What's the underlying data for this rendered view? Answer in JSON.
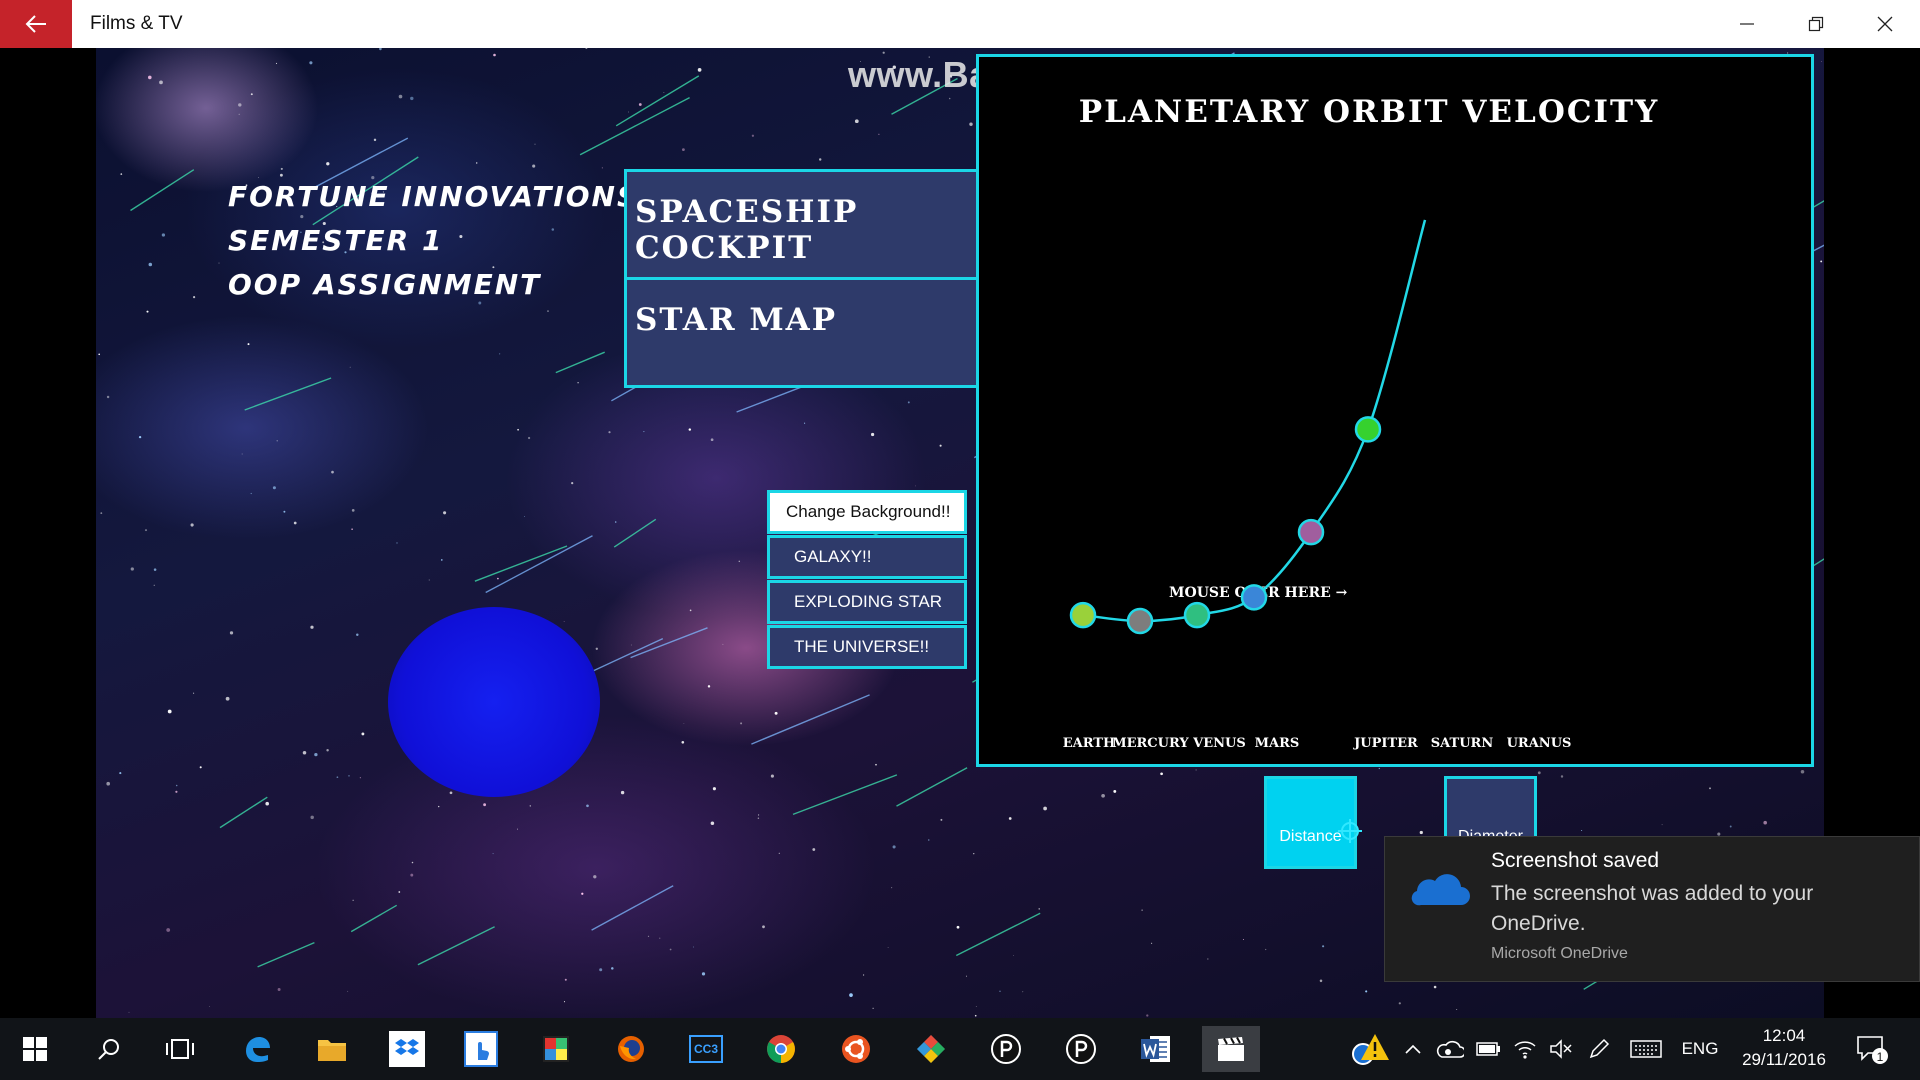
{
  "window": {
    "title": "Films & TV"
  },
  "video": {
    "watermark": "www.Bandicam.com",
    "heading": [
      "FORTUNE INNOVATIONS",
      "SEMESTER 1",
      "OOP ASSIGNMENT"
    ],
    "nav": {
      "spaceship": "SPACESHIP COCKPIT",
      "starmap": "STAR MAP"
    },
    "background_menu": {
      "title": "Change Background!!",
      "items": [
        "GALAXY!!",
        "EXPLODING STAR",
        "THE UNIVERSE!!"
      ]
    },
    "chart_buttons": {
      "distance": "Distance",
      "diameter": "Diameter"
    },
    "colors": {
      "accent": "#1bd6e6",
      "panel": "#2e3a6a",
      "planet": "#1520f0"
    }
  },
  "chart_data": {
    "type": "line",
    "title": "PLANETARY ORBIT VELOCITY",
    "annotation": "MOUSE OVER HERE →",
    "categories": [
      "EARTH",
      "MERCURY",
      "VENUS",
      "MARS",
      "JUPITER",
      "SATURN",
      "URANUS"
    ],
    "category_labels": [
      "EARTH",
      "MERCURY VENUS",
      "MARS",
      "JUPITER",
      "SATURN",
      "URANUS"
    ],
    "values": [
      0.5,
      0.2,
      0.5,
      1.4,
      4.7,
      9.9,
      20.5
    ],
    "marker_colors": [
      "#9ad13a",
      "#7d7d7d",
      "#2fbf80",
      "#3a86d8",
      "#a05e9e",
      "#36d12e",
      "#2c6fd6"
    ],
    "line_color": "#22d8e6",
    "ylim": [
      0,
      25
    ],
    "grid": false
  },
  "toast": {
    "title": "Screenshot saved",
    "body": "The screenshot was added to your OneDrive.",
    "source": "Microsoft OneDrive",
    "icon": "onedrive-cloud-icon"
  },
  "taskbar": {
    "apps": [
      "start-icon",
      "search-icon",
      "task-view-icon",
      "edge-icon",
      "file-explorer-icon",
      "dropbox-icon",
      "touch-app-icon",
      "paint-app-icon",
      "firefox-icon",
      "cc3-app-icon",
      "chrome-icon",
      "ubuntu-icon",
      "kodi-icon",
      "p3d-app-icon",
      "p3d-app-icon",
      "word-icon",
      "films-tv-icon"
    ],
    "cc3_label": "CC3",
    "language": "ENG",
    "time": "12:04",
    "date": "29/11/2016",
    "notification_count": "1"
  }
}
